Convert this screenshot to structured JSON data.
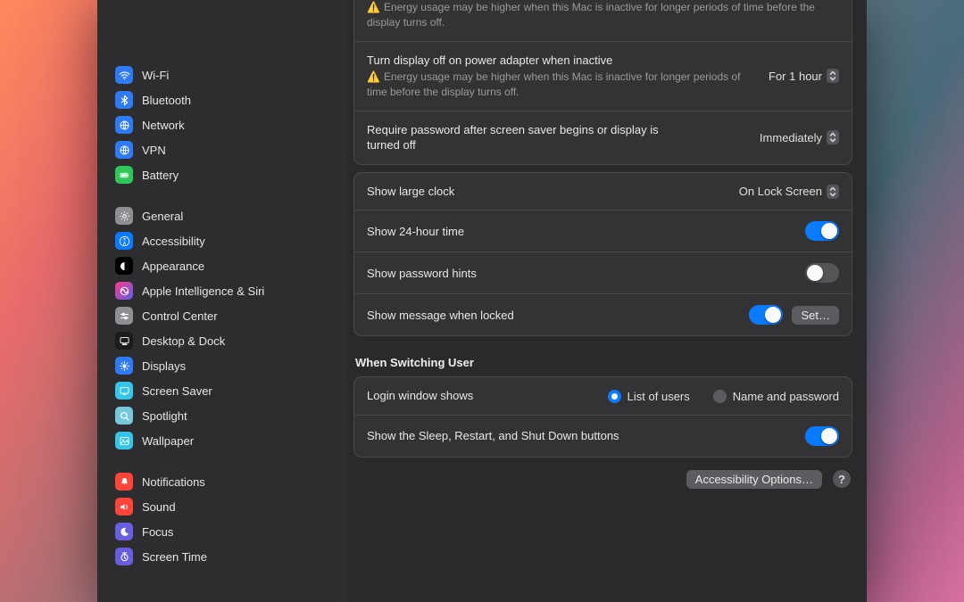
{
  "colors": {
    "accent": "#0a7aff"
  },
  "sidebar": {
    "groups": [
      [
        {
          "label": "Wi-Fi",
          "icon": "wifi-icon",
          "c1": "#2f7bf6",
          "c2": "#2f7bf6"
        },
        {
          "label": "Bluetooth",
          "icon": "bluetooth-icon",
          "c1": "#2f7bf6",
          "c2": "#2f7bf6"
        },
        {
          "label": "Network",
          "icon": "network-icon",
          "c1": "#2f7bf6",
          "c2": "#2f7bf6"
        },
        {
          "label": "VPN",
          "icon": "vpn-icon",
          "c1": "#2f7bf6",
          "c2": "#2f7bf6"
        },
        {
          "label": "Battery",
          "icon": "battery-icon",
          "c1": "#31c658",
          "c2": "#31c658"
        }
      ],
      [
        {
          "label": "General",
          "icon": "general-icon",
          "c1": "#8e8e93",
          "c2": "#8e8e93"
        },
        {
          "label": "Accessibility",
          "icon": "accessibility-icon",
          "c1": "#0a7aff",
          "c2": "#0a7aff"
        },
        {
          "label": "Appearance",
          "icon": "appearance-icon",
          "c1": "#000000",
          "c2": "#000000"
        },
        {
          "label": "Apple Intelligence & Siri",
          "icon": "siri-icon",
          "c1": "#ff3b8b",
          "c2": "#5e5ce6"
        },
        {
          "label": "Control Center",
          "icon": "control-center-icon",
          "c1": "#8e8e93",
          "c2": "#8e8e93"
        },
        {
          "label": "Desktop & Dock",
          "icon": "desktop-dock-icon",
          "c1": "#1c1c1e",
          "c2": "#1c1c1e"
        },
        {
          "label": "Displays",
          "icon": "displays-icon",
          "c1": "#2f7bf6",
          "c2": "#2f7bf6"
        },
        {
          "label": "Screen Saver",
          "icon": "screen-saver-icon",
          "c1": "#35c5e8",
          "c2": "#35c5e8"
        },
        {
          "label": "Spotlight",
          "icon": "spotlight-icon",
          "c1": "#77c8dc",
          "c2": "#77c8dc"
        },
        {
          "label": "Wallpaper",
          "icon": "wallpaper-icon",
          "c1": "#35c5e8",
          "c2": "#35c5e8"
        }
      ],
      [
        {
          "label": "Notifications",
          "icon": "notifications-icon",
          "c1": "#ff453a",
          "c2": "#ff453a"
        },
        {
          "label": "Sound",
          "icon": "sound-icon",
          "c1": "#ff453a",
          "c2": "#ff453a"
        },
        {
          "label": "Focus",
          "icon": "focus-icon",
          "c1": "#6a5ee0",
          "c2": "#6a5ee0"
        },
        {
          "label": "Screen Time",
          "icon": "screen-time-icon",
          "c1": "#6a5ee0",
          "c2": "#6a5ee0"
        }
      ]
    ]
  },
  "main": {
    "panel_truncated": {
      "row0_prev_note": "Energy usage may be higher when this Mac is inactive for longer periods of time before the display turns off.",
      "row1_title": "Turn display off on power adapter when inactive",
      "row1_value": "For 1 hour",
      "row1_note": "Energy usage may be higher when this Mac is inactive for longer periods of time before the display turns off.",
      "row2_title": "Require password after screen saver begins or display is turned off",
      "row2_value": "Immediately"
    },
    "panel_clock": {
      "large_clock_label": "Show large clock",
      "large_clock_value": "On Lock Screen",
      "twentyfour_label": "Show 24-hour time",
      "twentyfour_state": "on",
      "hints_label": "Show password hints",
      "hints_state": "off",
      "msg_label": "Show message when locked",
      "msg_state": "on",
      "msg_button": "Set…"
    },
    "switching_heading": "When Switching User",
    "panel_switching": {
      "login_shows_label": "Login window shows",
      "option_list": "List of users",
      "option_namepw": "Name and password",
      "selected": "list",
      "sleep_restart_label": "Show the Sleep, Restart, and Shut Down buttons",
      "sleep_restart_state": "on"
    },
    "footer": {
      "accessibility_options": "Accessibility Options…",
      "help": "?"
    }
  }
}
